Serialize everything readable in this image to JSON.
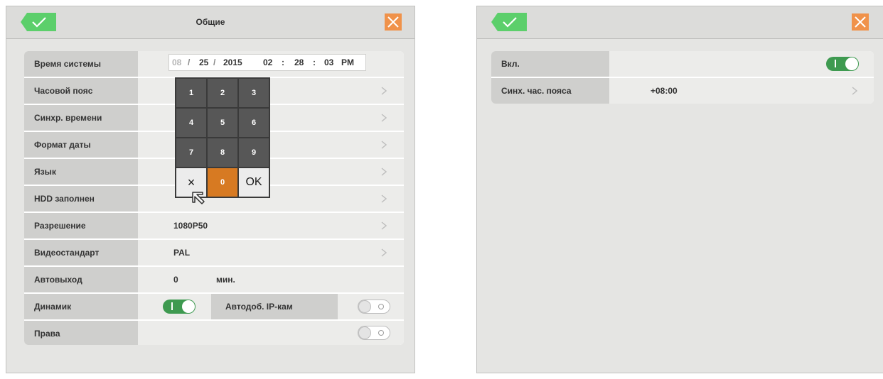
{
  "left_panel": {
    "title": "Общие",
    "datetime": {
      "month": "08",
      "sep1": "/",
      "day": "25",
      "sep2": "/",
      "year": "2015",
      "hour": "02",
      "colon1": ":",
      "minute": "28",
      "colon2": ":",
      "second": "03",
      "ampm": "PM"
    },
    "rows": {
      "system_time": "Время системы",
      "timezone": "Часовой пояс",
      "time_sync": "Синхр. времени",
      "date_format": "Формат даты",
      "language": "Язык",
      "hdd_full": "HDD заполнен",
      "resolution": "Разрешение",
      "resolution_value": "1080P50",
      "video_standard": "Видеостандарт",
      "video_standard_value": "PAL",
      "auto_exit": "Автовыход",
      "auto_exit_value": "0",
      "auto_exit_unit": "мин.",
      "speaker": "Динамик",
      "auto_add_ipcam": "Автодоб. IP-кам",
      "rights": "Права"
    },
    "keypad": {
      "k1": "1",
      "k2": "2",
      "k3": "3",
      "k4": "4",
      "k5": "5",
      "k6": "6",
      "k7": "7",
      "k8": "8",
      "k9": "9",
      "clear": "×",
      "k0": "0",
      "ok": "OK"
    },
    "toggles": {
      "speaker": "on",
      "auto_add_ipcam": "off",
      "rights": "off"
    }
  },
  "right_panel": {
    "rows": {
      "enabled": "Вкл.",
      "tz_sync": "Синх. час. пояса",
      "tz_sync_value": "+08:00"
    },
    "toggles": {
      "enabled": "on"
    }
  },
  "colors": {
    "ok_green": "#5ccf6b",
    "close_orange": "#f0924a",
    "toggle_green": "#3e9a50",
    "key_active": "#d77a22"
  },
  "icons": [
    "check-icon",
    "close-icon",
    "chevron-right-icon",
    "mouse-cursor-icon"
  ]
}
